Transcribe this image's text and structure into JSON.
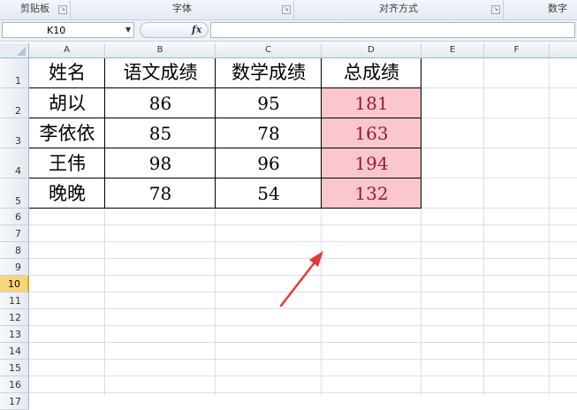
{
  "ribbon": {
    "groups": [
      "剪贴板",
      "字体",
      "对齐方式",
      "数字"
    ]
  },
  "formula_bar": {
    "name_box": "K10",
    "fx_label": "fx",
    "formula": ""
  },
  "columns": [
    "A",
    "B",
    "C",
    "D",
    "E",
    "F"
  ],
  "rows": [
    "1",
    "2",
    "3",
    "4",
    "5",
    "6",
    "7",
    "8",
    "9",
    "10",
    "11",
    "12",
    "13",
    "14",
    "15",
    "16",
    "17"
  ],
  "selected_row": "10",
  "table": {
    "headers": [
      "姓名",
      "语文成绩",
      "数学成绩",
      "总成绩"
    ],
    "rows": [
      [
        "胡以",
        "86",
        "95",
        "181"
      ],
      [
        "李依依",
        "85",
        "78",
        "163"
      ],
      [
        "王伟",
        "98",
        "96",
        "194"
      ],
      [
        "晚晚",
        "78",
        "54",
        "132"
      ]
    ]
  },
  "colors": {
    "total_fill": "#fbc7cf",
    "total_text": "#9c1b2b",
    "arrow": "#e53935",
    "selected_row_header": "#f7d67a"
  }
}
